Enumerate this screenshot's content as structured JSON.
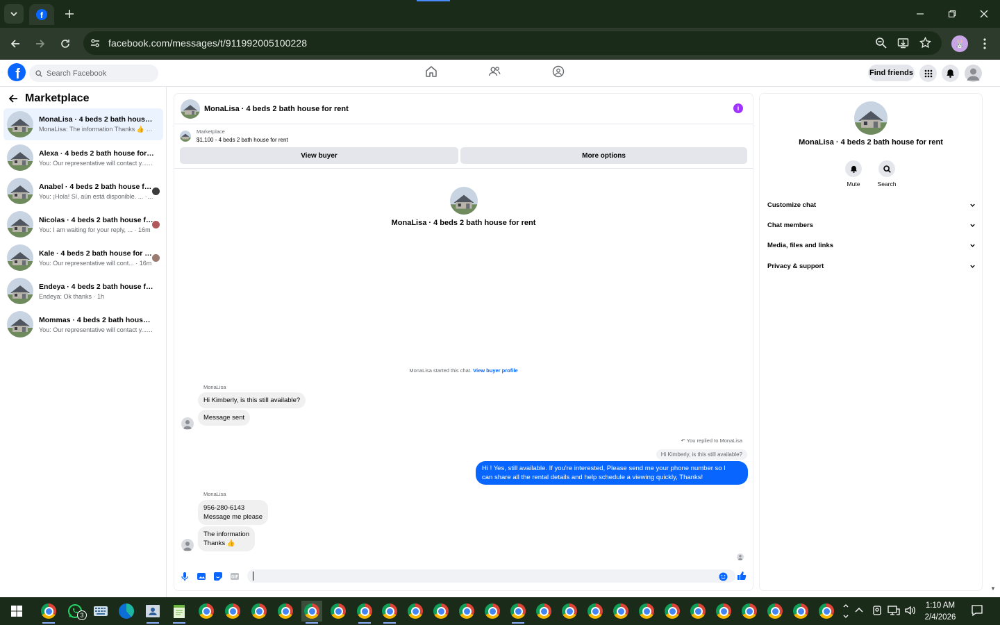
{
  "browser": {
    "url": "facebook.com/messages/t/911992005100228",
    "profile_initial": "🐰"
  },
  "fb": {
    "search_placeholder": "Search Facebook",
    "find_friends": "Find friends"
  },
  "left": {
    "title": "Marketplace",
    "conversations": [
      {
        "name": "MonaLisa · 4 beds 2 bath house fo...",
        "preview": "MonaLisa: The information Thanks 👍 · 1m"
      },
      {
        "name": "Alexa · 4 beds 2 bath house for rent",
        "preview": "You: Our representative will contact y... · 3m"
      },
      {
        "name": "Anabel · 4 beds 2 bath house fo...",
        "preview": "You: ¡Hola! Sí, aún está disponible. ... · 6m"
      },
      {
        "name": "Nicolas · 4 beds 2 bath house fo...",
        "preview": "You: I am waiting for your reply, ... · 16m"
      },
      {
        "name": "Kale · 4 beds 2 bath house for re...",
        "preview": "You: Our representative will cont... · 16m"
      },
      {
        "name": "Endeya · 4 beds 2 bath house for r...",
        "preview": "Endeya: Ok thanks · 1h"
      },
      {
        "name": "Mommas · 4 beds 2 bath house fo...",
        "preview": "You: Our representative will contact y... · 4h"
      }
    ]
  },
  "chat": {
    "title": "MonaLisa · 4 beds 2 bath house for rent",
    "marketplace_label": "Marketplace",
    "listing": "$1,100 - 4 beds 2 bath house for rent",
    "view_buyer": "View buyer",
    "more_options": "More options",
    "intro_title": "MonaLisa · 4 beds 2 bath house for rent",
    "started_text": "MonaLisa started this chat.",
    "view_buyer_profile": "View buyer profile",
    "sender_name": "MonaLisa",
    "msg1": "Hi Kimberly, is this still available?",
    "msg2": "Message sent",
    "replied_label": "You replied to MonaLisa",
    "quoted": "Hi Kimberly, is this still available?",
    "outgoing_line1": "Hi ! Yes, still available. If you're interested, Please send me your phone number so I",
    "outgoing_line2": "can share all the rental details and help schedule a viewing quickly, Thanks!",
    "sender_name2": "MonaLisa",
    "msg3_line1": "956-280-6143",
    "msg3_line2": "Message me please",
    "msg4_line1": "The information",
    "msg4_line2": "Thanks 👍"
  },
  "right": {
    "title": "MonaLisa · 4 beds 2 bath house for rent",
    "mute": "Mute",
    "search": "Search",
    "sections": [
      "Customize chat",
      "Chat members",
      "Media, files and links",
      "Privacy & support"
    ]
  },
  "taskbar": {
    "whatsapp_badge": "3",
    "time": "1:10 AM",
    "date": "2/4/2026"
  }
}
